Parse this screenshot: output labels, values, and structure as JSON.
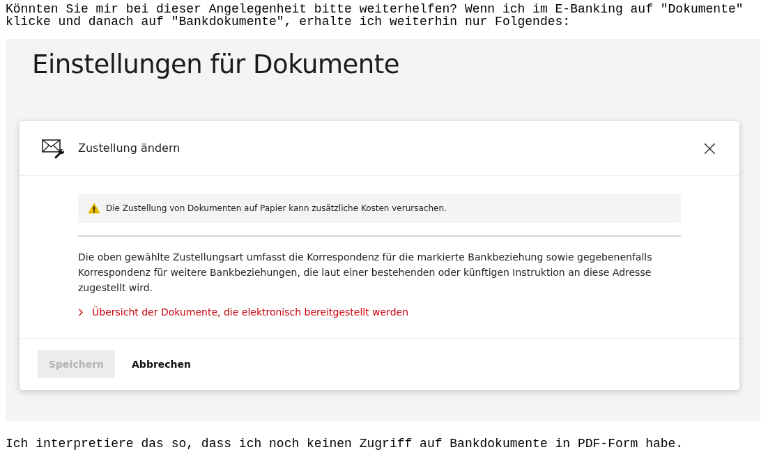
{
  "post_intro": "Könnten Sie mir bei dieser Angelegenheit bitte weiterhelfen? Wenn ich im E-Banking auf \"Dokumente\"\nklicke und danach auf \"Bankdokumente\", erhalte ich weiterhin nur Folgendes:",
  "screenshot": {
    "page_title": "Einstellungen für Dokumente",
    "dialog": {
      "title": "Zustellung ändern",
      "close": "×",
      "warning": "Die Zustellung von Dokumenten auf Papier kann zusätzliche Kosten verursachen.",
      "description": "Die oben gewählte Zustellungsart umfasst die Korrespondenz für die markierte Bankbeziehung sowie gegebenenfalls Korrespondenz für weitere Bankbeziehungen, die laut einer bestehenden oder künftigen Instruktion an diese Adresse zugestellt wird.",
      "link": "Übersicht der Dokumente, die elektronisch bereitgestellt werden",
      "buttons": [
        {
          "label": "Speichern",
          "kind": "primary",
          "disabled": true
        },
        {
          "label": "Abbrechen",
          "kind": "secondary",
          "disabled": false
        }
      ]
    }
  },
  "post_outro": "Ich interpretiere das so, dass ich noch keinen Zugriff auf Bankdokumente in PDF-Form habe."
}
